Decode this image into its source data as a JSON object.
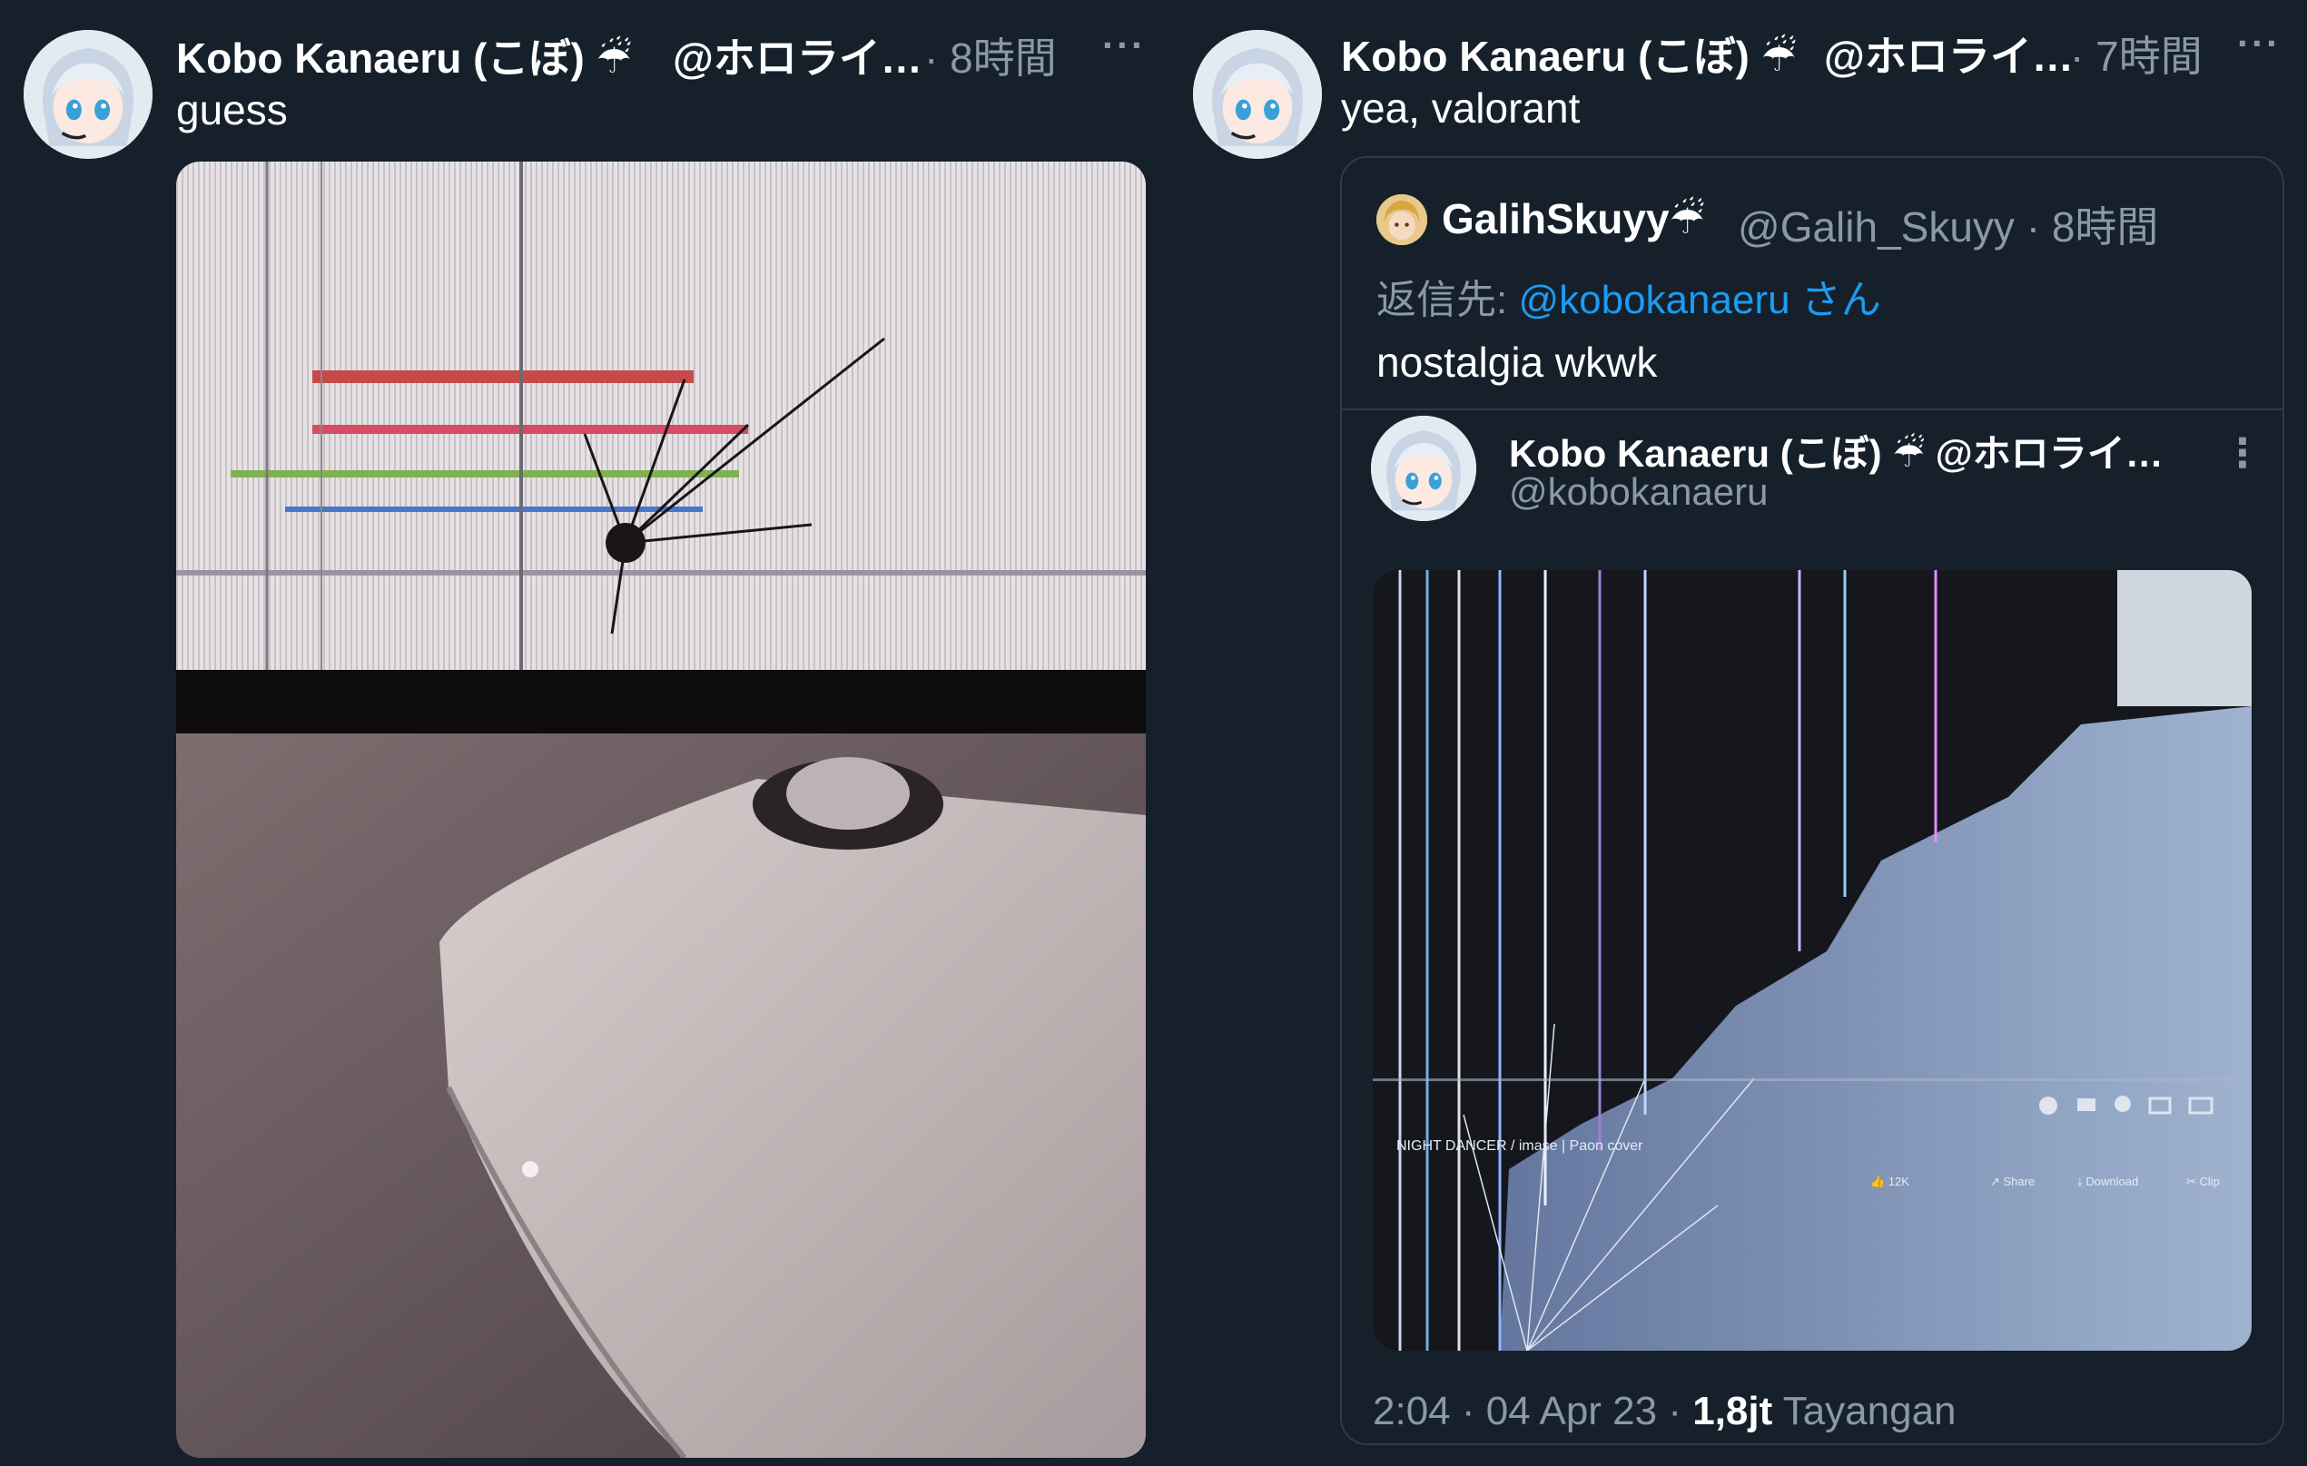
{
  "tweet_left": {
    "author_name": "Kobo Kanaeru (こぼ)",
    "author_emoji": "☔",
    "handle": "@ホロライ…",
    "time": "8時間",
    "more": "···",
    "text": "guess"
  },
  "tweet_right": {
    "author_name": "Kobo Kanaeru (こぼ)",
    "author_emoji": "☔",
    "handle": "@ホロライ…",
    "time": "7時間",
    "more": "···",
    "text": "yea, valorant",
    "reply": {
      "author_name": "GalihSkuyy",
      "author_emoji": "☔",
      "handle": "@Galih_Skuyy",
      "time": "8時間",
      "reply_to_prefix": "返信先:",
      "reply_to_handle": "@kobokanaeru さん",
      "text": "nostalgia wkwk"
    },
    "quoted": {
      "author_name": "Kobo Kanaeru (こぼ)",
      "author_emoji": "☔",
      "handle_short": "@ホロライ…",
      "handle": "@kobokanaeru",
      "more": "⋮",
      "video_title": "NIGHT DANCER / imase | Paon cover",
      "buttons": [
        "12K",
        "Share",
        "Download",
        "Clip"
      ],
      "timestamp": "2:04 · 04 Apr 23 · ",
      "views_count": "1,8jt",
      "views_label": "Tayangan"
    }
  },
  "colors": {
    "background": "#15202b",
    "text": "#ffffff",
    "muted": "#8b98a5",
    "link": "#1d9bf0",
    "border": "#2f3b47"
  }
}
